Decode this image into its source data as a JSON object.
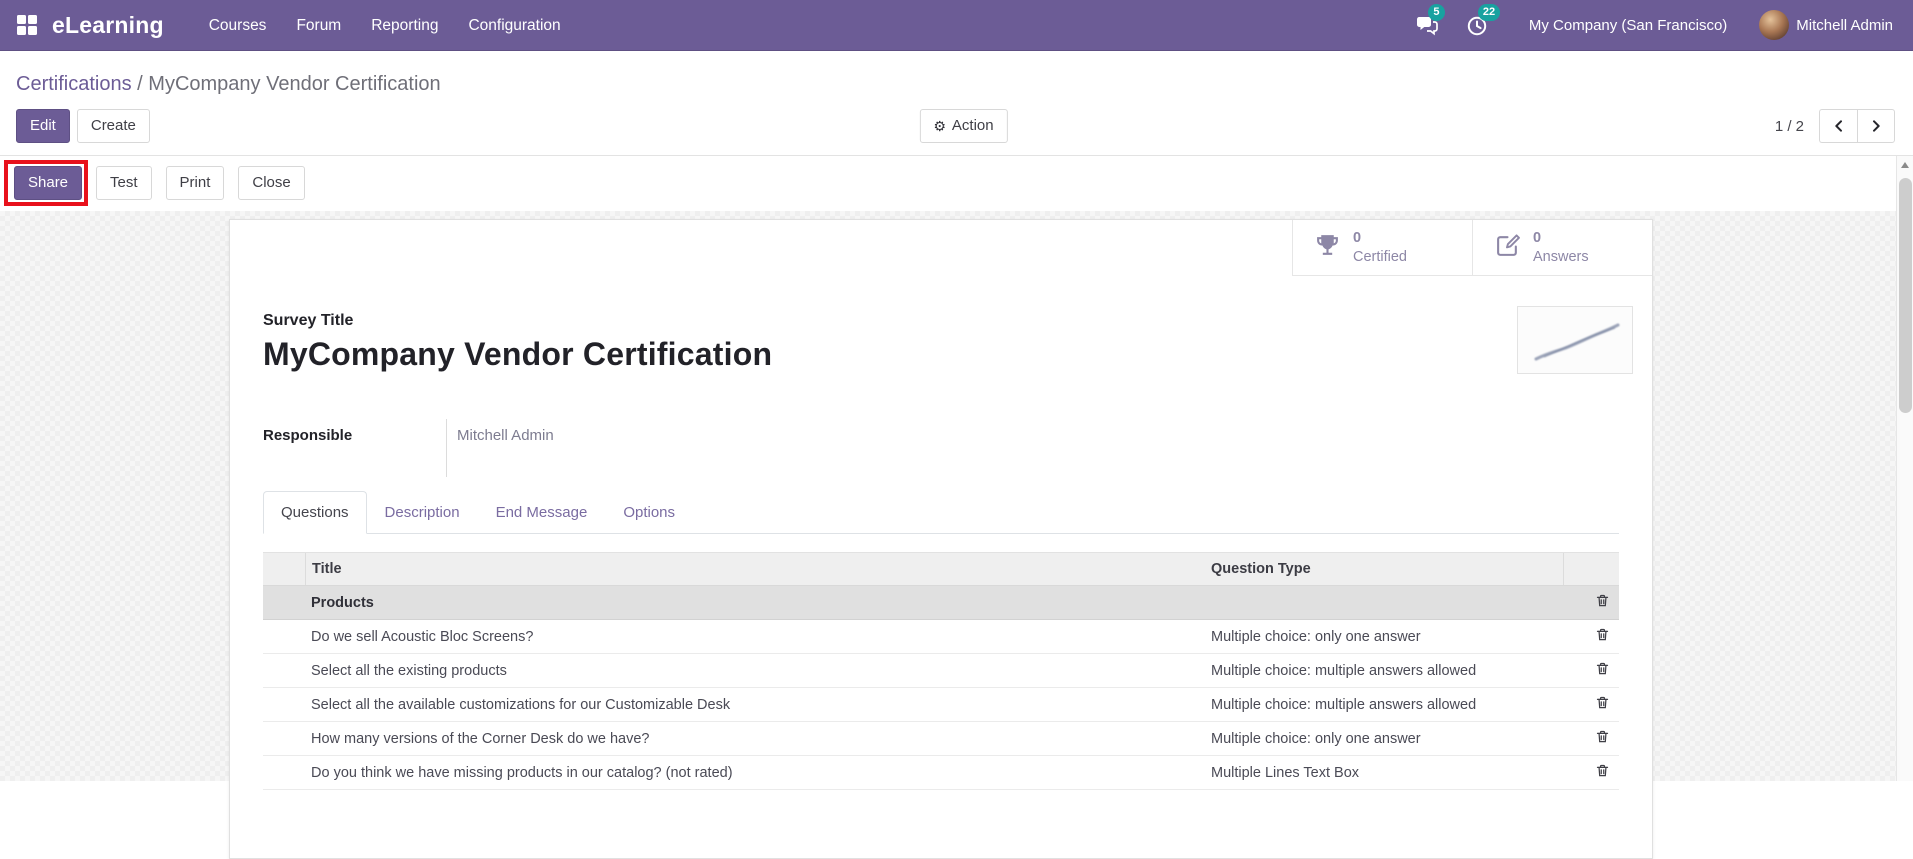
{
  "colors": {
    "accent": "#6c5c96",
    "badge": "#18a2a0",
    "annotation": "#e8111c"
  },
  "navbar": {
    "brand": "eLearning",
    "menus": [
      "Courses",
      "Forum",
      "Reporting",
      "Configuration"
    ],
    "messages_badge": "5",
    "activities_badge": "22",
    "company": "My Company (San Francisco)",
    "user": "Mitchell Admin"
  },
  "breadcrumb": {
    "parent": "Certifications",
    "separator": " / ",
    "current": "MyCompany Vendor Certification"
  },
  "control": {
    "edit": "Edit",
    "create": "Create",
    "action": "Action",
    "pager_count": "1 / 2"
  },
  "header_actions": {
    "share": "Share",
    "test": "Test",
    "print": "Print",
    "close": "Close"
  },
  "stats": [
    {
      "value": "0",
      "label": "Certified"
    },
    {
      "value": "0",
      "label": "Answers"
    }
  ],
  "form": {
    "title_label": "Survey Title",
    "title": "MyCompany Vendor Certification",
    "responsible_label": "Responsible",
    "responsible": "Mitchell Admin"
  },
  "tabs": [
    {
      "label": "Questions",
      "active": true
    },
    {
      "label": "Description"
    },
    {
      "label": "End Message"
    },
    {
      "label": "Options"
    }
  ],
  "table": {
    "headers": {
      "title": "Title",
      "type": "Question Type"
    },
    "rows": [
      {
        "title": "Products",
        "type": "",
        "group": true
      },
      {
        "title": "Do we sell Acoustic Bloc Screens?",
        "type": "Multiple choice: only one answer"
      },
      {
        "title": "Select all the existing products",
        "type": "Multiple choice: multiple answers allowed"
      },
      {
        "title": "Select all the available customizations for our Customizable Desk",
        "type": "Multiple choice: multiple answers allowed"
      },
      {
        "title": "How many versions of the Corner Desk do we have?",
        "type": "Multiple choice: only one answer"
      },
      {
        "title": "Do you think we have missing products in our catalog? (not rated)",
        "type": "Multiple Lines Text Box"
      }
    ]
  }
}
